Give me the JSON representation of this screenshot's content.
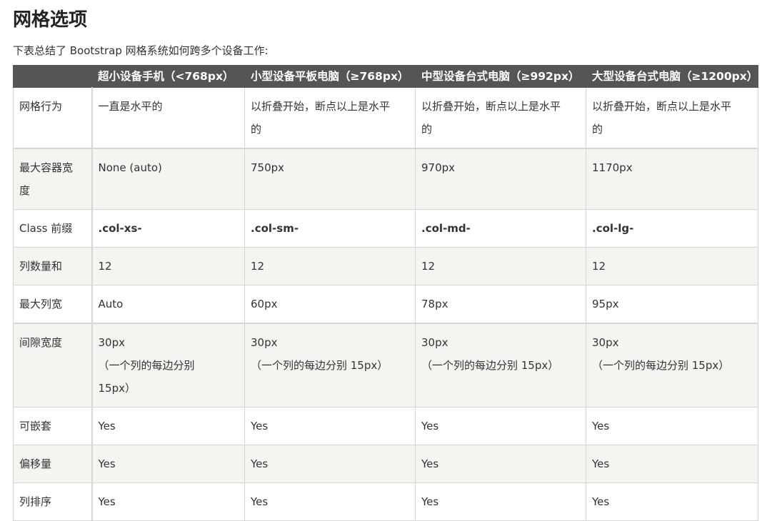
{
  "page": {
    "title": "网格选项",
    "intro": "下表总结了 Bootstrap 网格系统如何跨多个设备工作:"
  },
  "table": {
    "headers": [
      "",
      "超小设备手机（<768px）",
      "小型设备平板电脑（≥768px）",
      "中型设备台式电脑（≥992px）",
      "大型设备台式电脑（≥1200px）"
    ],
    "rows": {
      "r0": {
        "label": "网格行为",
        "c1": "一直是水平的",
        "c2a": "以折叠开始，断点以上是水平",
        "c2b": "的",
        "c3a": "以折叠开始，断点以上是水平",
        "c3b": "的",
        "c4a": "以折叠开始，断点以上是水平",
        "c4b": "的"
      },
      "r1": {
        "label_a": "最大容器宽",
        "label_b": "度",
        "c1": "None (auto)",
        "c2": "750px",
        "c3": "970px",
        "c4": "1170px"
      },
      "r2": {
        "label": "Class 前缀",
        "c1": ".col-xs-",
        "c2": ".col-sm-",
        "c3": ".col-md-",
        "c4": ".col-lg-"
      },
      "r3": {
        "label": "列数量和",
        "c1": "12",
        "c2": "12",
        "c3": "12",
        "c4": "12"
      },
      "r4": {
        "label": "最大列宽",
        "c1": "Auto",
        "c2": "60px",
        "c3": "78px",
        "c4": "95px"
      },
      "r5": {
        "label": "间隙宽度",
        "c1a": "30px",
        "c1b": "（一个列的每边分别",
        "c1c": "15px）",
        "c2a": "30px",
        "c2b": "（一个列的每边分别 15px）",
        "c3a": "30px",
        "c3b": "（一个列的每边分别 15px）",
        "c4a": "30px",
        "c4b": "（一个列的每边分别 15px）"
      },
      "r6": {
        "label": "可嵌套",
        "c1": "Yes",
        "c2": "Yes",
        "c3": "Yes",
        "c4": "Yes"
      },
      "r7": {
        "label": "偏移量",
        "c1": "Yes",
        "c2": "Yes",
        "c3": "Yes",
        "c4": "Yes"
      },
      "r8": {
        "label": "列排序",
        "c1": "Yes",
        "c2": "Yes",
        "c3": "Yes",
        "c4": "Yes"
      }
    }
  }
}
